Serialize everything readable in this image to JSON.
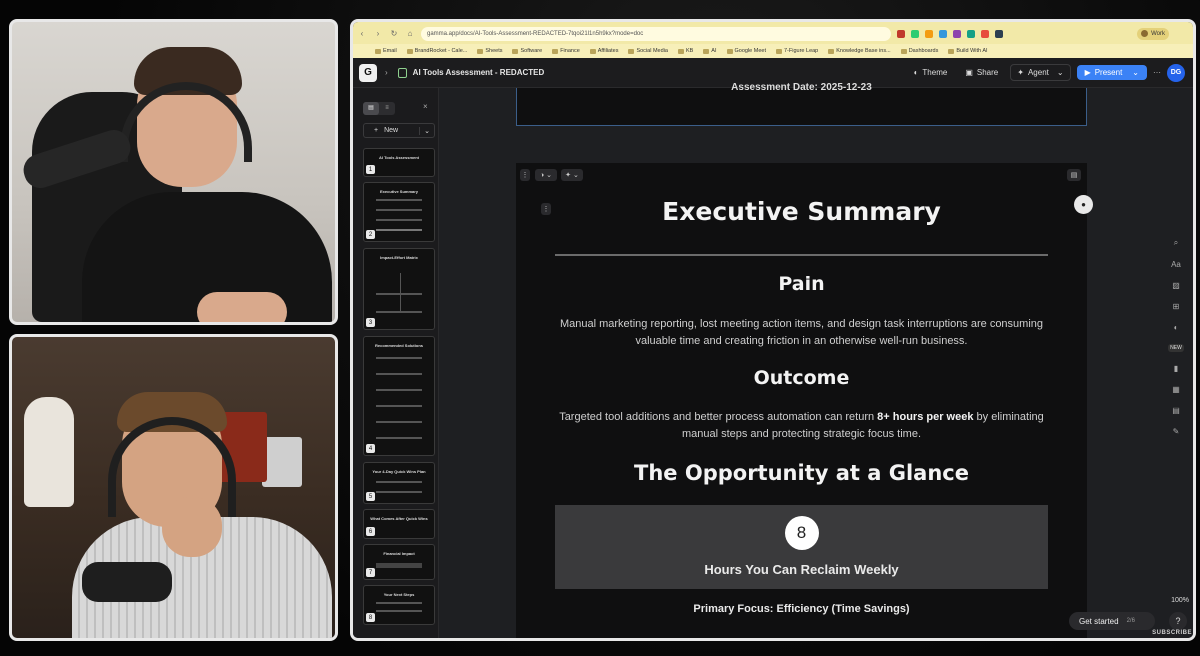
{
  "browser": {
    "url": "gamma.app/docs/AI-Tools-Assessment-REDACTED-7tqoi21l1n5h9kx?mode=doc",
    "profile": "Work",
    "bookmarks": [
      "Email",
      "BrandRocket - Cale...",
      "Sheets",
      "Software",
      "Finance",
      "Affiliates",
      "Social Media",
      "KB",
      "AI",
      "Google Meet",
      "7-Figure Leap",
      "Knowledge Base ins...",
      "Dashboards",
      "Build With AI"
    ]
  },
  "app": {
    "logo": "G",
    "doc_title": "AI Tools Assessment - REDACTED",
    "theme_label": "Theme",
    "share_label": "Share",
    "agent_label": "Agent",
    "present_label": "Present",
    "avatar_initials": "DG",
    "new_label": "New"
  },
  "thumbs": [
    {
      "num": "1",
      "title": "AI Tools Assessment"
    },
    {
      "num": "2",
      "title": "Executive Summary"
    },
    {
      "num": "3",
      "title": "Impact-Effort Matrix"
    },
    {
      "num": "4",
      "title": "Recommended Solutions"
    },
    {
      "num": "5",
      "title": "Your 4-Day Quick Wins Plan"
    },
    {
      "num": "6",
      "title": "What Comes After Quick Wins"
    },
    {
      "num": "7",
      "title": "Financial Impact"
    },
    {
      "num": "8",
      "title": "Your Next Steps"
    }
  ],
  "slide": {
    "partial_header": "Assessment Date: 2025-12-23",
    "title": "Executive Summary",
    "pain_heading": "Pain",
    "pain_text": "Manual marketing reporting, lost meeting action items, and design task interruptions are consuming valuable time and creating friction in an otherwise well-run business.",
    "outcome_heading": "Outcome",
    "outcome_text_before": "Targeted tool additions and better process automation can return ",
    "outcome_text_bold": "8+ hours per week",
    "outcome_text_after": " by eliminating manual steps and protecting strategic focus time.",
    "opportunity_heading": "The Opportunity at a Glance",
    "stat_value": "8",
    "stat_label": "Hours You Can Reclaim Weekly",
    "primary_focus": "Primary Focus: Efficiency (Time Savings)"
  },
  "rail": {
    "new_badge": "NEW"
  },
  "footer": {
    "get_started": "Get started",
    "progress": "2/6",
    "help": "?",
    "zoom": "100%",
    "subscribe": "SUBSCRIBE"
  }
}
